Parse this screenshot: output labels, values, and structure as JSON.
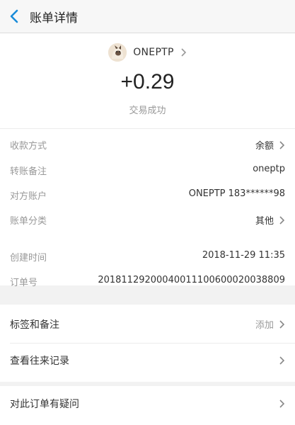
{
  "header": {
    "title": "账单详情",
    "back_icon": "chevron-left-icon",
    "accent": "#1a8cd8"
  },
  "payee": {
    "name": "ONEPTP"
  },
  "transaction": {
    "amount": "+0.29",
    "status": "交易成功"
  },
  "details": [
    {
      "label": "收款方式",
      "value": "余额"
    },
    {
      "label": "转账备注",
      "value": "oneptp"
    },
    {
      "label": "对方账户",
      "value": "ONEPTP 183******98"
    },
    {
      "label": "账单分类",
      "value": "其他"
    },
    {
      "label": "创建时间",
      "value": "2018-11-29 11:35"
    },
    {
      "label": "订单号",
      "value": "20181129200040011100600020038809"
    }
  ],
  "actions": {
    "tags": {
      "label": "标签和备注",
      "action": "添加"
    },
    "history": {
      "label": "查看往来记录"
    },
    "question": {
      "label": "对此订单有疑问"
    }
  }
}
